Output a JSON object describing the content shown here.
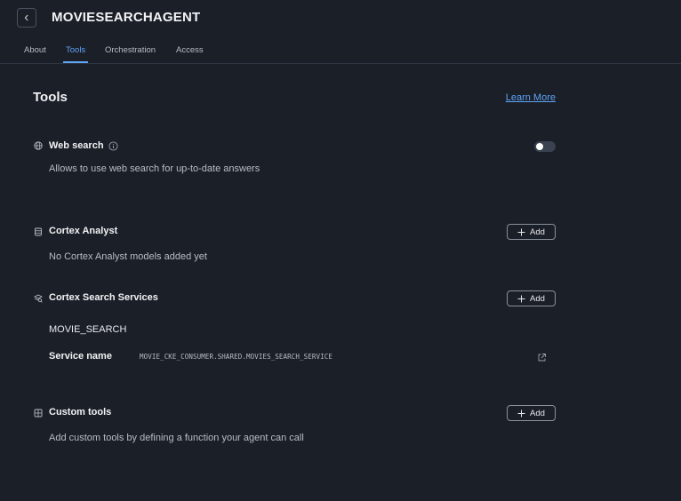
{
  "header": {
    "title": "MOVIESEARCHAGENT",
    "tabs": [
      {
        "label": "About"
      },
      {
        "label": "Tools"
      },
      {
        "label": "Orchestration"
      },
      {
        "label": "Access"
      }
    ],
    "active_tab": "Tools"
  },
  "main": {
    "title": "Tools",
    "learn_more": "Learn More",
    "web_search": {
      "title": "Web search",
      "description": "Allows to use web search for up-to-date answers",
      "enabled": false,
      "icon": "globe-icon"
    },
    "cortex_analyst": {
      "title": "Cortex Analyst",
      "description": "No Cortex Analyst models added yet",
      "add_label": "Add",
      "icon": "database-icon"
    },
    "cortex_search": {
      "title": "Cortex Search Services",
      "add_label": "Add",
      "service": "MOVIE_SEARCH",
      "service_name_label": "Service name",
      "service_name_value": "MOVIE_CKE_CONSUMER.SHARED.MOVIES_SEARCH_SERVICE",
      "icon": "search-stack-icon"
    },
    "custom_tools": {
      "title": "Custom tools",
      "description": "Add custom tools by defining a function your agent can call",
      "add_label": "Add",
      "icon": "grid-icon"
    }
  },
  "colors": {
    "background": "#1b1f28",
    "accent": "#5fa3f5",
    "text": "#e8eaee",
    "muted": "#b7bcc7"
  }
}
